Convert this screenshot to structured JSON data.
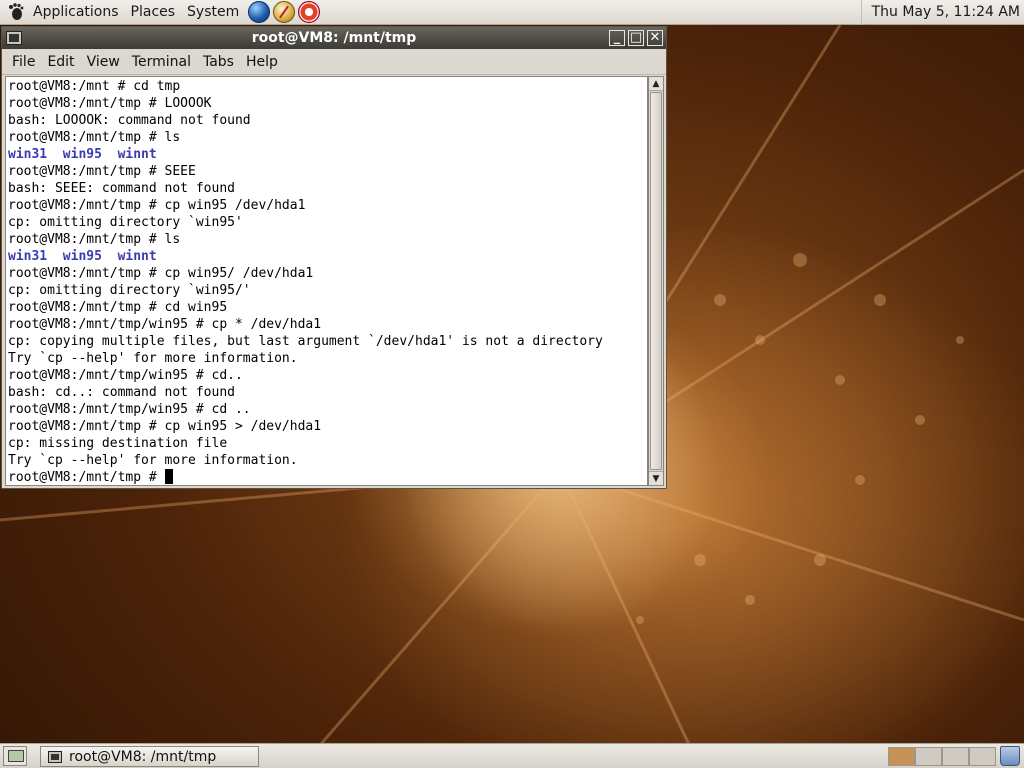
{
  "top_panel": {
    "menus": [
      "Applications",
      "Places",
      "System"
    ],
    "launchers": [
      "web-browser-icon",
      "compass-icon",
      "help-icon"
    ],
    "clock": "Thu May  5, 11:24 AM"
  },
  "window": {
    "title": "root@VM8: /mnt/tmp",
    "buttons": {
      "minimize": "_",
      "maximize": "□",
      "close": "✕"
    },
    "menu": [
      "File",
      "Edit",
      "View",
      "Terminal",
      "Tabs",
      "Help"
    ],
    "lines": [
      {
        "text": "root@VM8:/mnt # cd tmp"
      },
      {
        "text": "root@VM8:/mnt/tmp # LOOOOK"
      },
      {
        "text": "bash: LOOOOK: command not found"
      },
      {
        "text": "root@VM8:/mnt/tmp # ls"
      },
      {
        "text": "win31  win95  winnt",
        "dir": true
      },
      {
        "text": "root@VM8:/mnt/tmp # SEEE"
      },
      {
        "text": "bash: SEEE: command not found"
      },
      {
        "text": "root@VM8:/mnt/tmp # cp win95 /dev/hda1"
      },
      {
        "text": "cp: omitting directory `win95'"
      },
      {
        "text": "root@VM8:/mnt/tmp # ls"
      },
      {
        "text": "win31  win95  winnt",
        "dir": true
      },
      {
        "text": "root@VM8:/mnt/tmp # cp win95/ /dev/hda1"
      },
      {
        "text": "cp: omitting directory `win95/'"
      },
      {
        "text": "root@VM8:/mnt/tmp # cd win95"
      },
      {
        "text": "root@VM8:/mnt/tmp/win95 # cp * /dev/hda1"
      },
      {
        "text": "cp: copying multiple files, but last argument `/dev/hda1' is not a directory"
      },
      {
        "text": "Try `cp --help' for more information."
      },
      {
        "text": "root@VM8:/mnt/tmp/win95 # cd.."
      },
      {
        "text": "bash: cd..: command not found"
      },
      {
        "text": "root@VM8:/mnt/tmp/win95 # cd .."
      },
      {
        "text": "root@VM8:/mnt/tmp # cp win95 > /dev/hda1"
      },
      {
        "text": "cp: missing destination file"
      },
      {
        "text": "Try `cp --help' for more information."
      },
      {
        "text": "root@VM8:/mnt/tmp # ",
        "cursor": true
      }
    ]
  },
  "bottom_panel": {
    "task_label": "root@VM8: /mnt/tmp",
    "workspaces": 4,
    "active_workspace": 1
  }
}
